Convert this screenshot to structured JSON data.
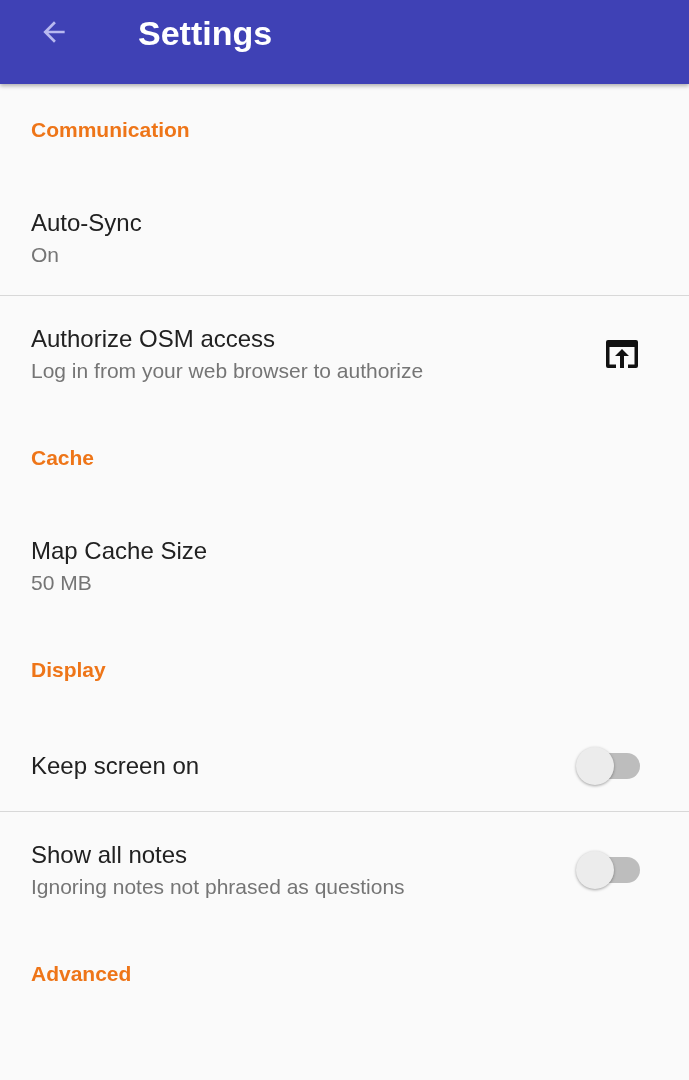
{
  "app_bar": {
    "title": "Settings"
  },
  "sections": [
    {
      "title": "Communication",
      "items": [
        {
          "kind": "text",
          "title": "Auto-Sync",
          "summary": "On",
          "divider": true
        },
        {
          "kind": "link",
          "title": "Authorize OSM access",
          "summary": "Log in from your web browser to authorize",
          "divider": false
        }
      ]
    },
    {
      "title": "Cache",
      "items": [
        {
          "kind": "text",
          "title": "Map Cache Size",
          "summary": "50 MB",
          "divider": false
        }
      ]
    },
    {
      "title": "Display",
      "items": [
        {
          "kind": "switch",
          "title": "Keep screen on",
          "on": false,
          "divider": true
        },
        {
          "kind": "switch",
          "title": "Show all notes",
          "summary": "Ignoring notes not phrased as questions",
          "on": false,
          "divider": false
        }
      ]
    },
    {
      "title": "Advanced"
    }
  ]
}
